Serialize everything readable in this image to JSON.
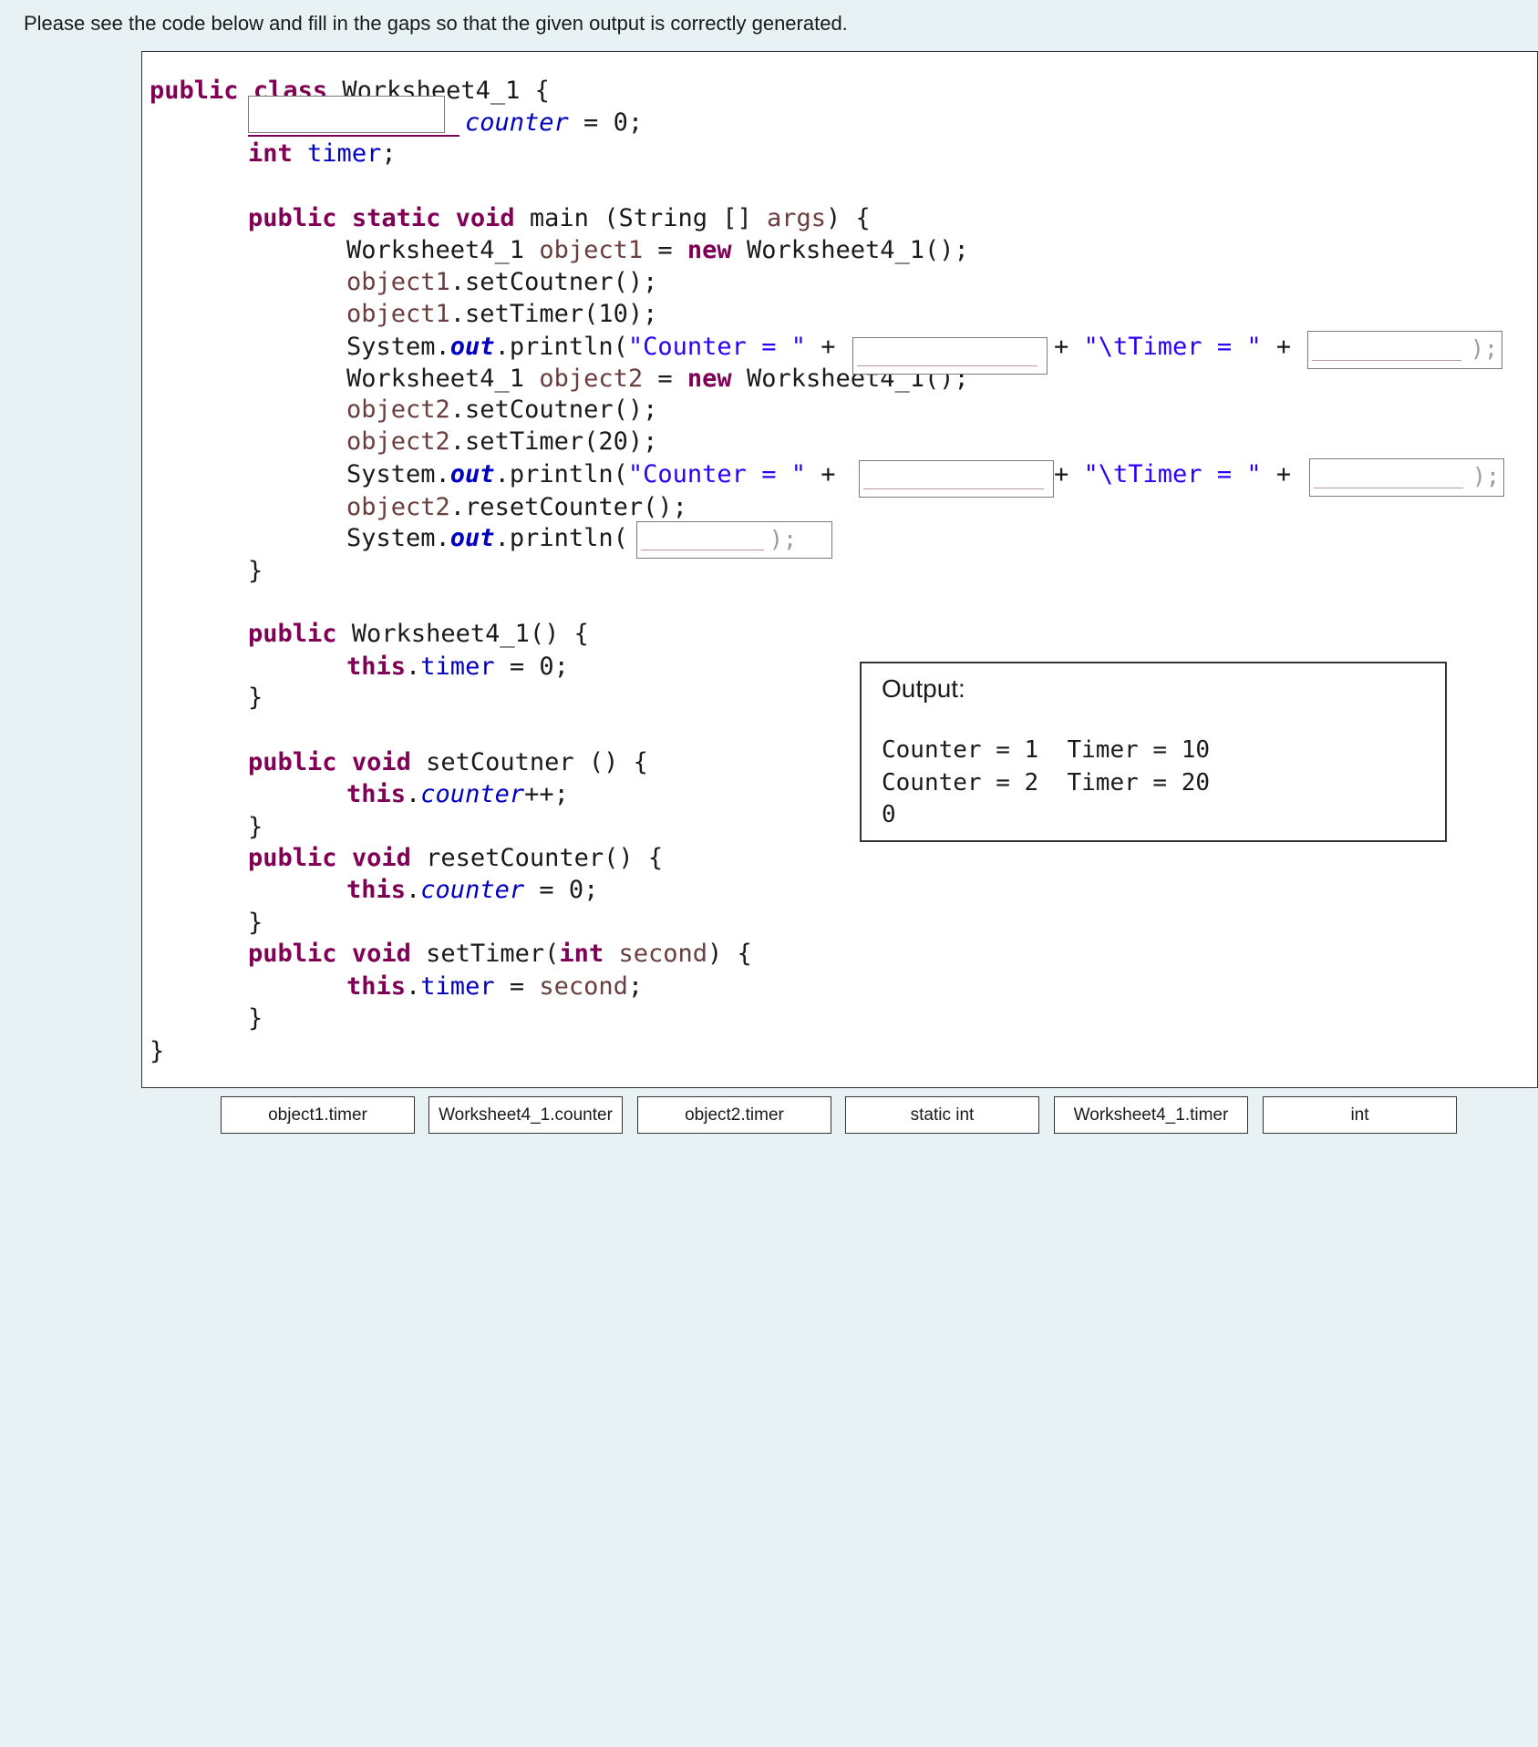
{
  "prompt": "Please see the code below and fill in the gaps so that the given output is correctly generated.",
  "code": {
    "l1": {
      "kw1": "public",
      "kw2": "class",
      "name": "Worksheet4_1 {"
    },
    "l2": {
      "field": "counter",
      "rest": " = 0;"
    },
    "l3": {
      "kw": "int",
      "field": "timer",
      "rest": ";"
    },
    "l4": {
      "kw1": "public",
      "kw2": "static",
      "kw3": "void",
      "name": " main (String [] ",
      "arg": "args",
      "rest": ") {"
    },
    "l5": {
      "type": "Worksheet4_1 ",
      "var": "object1",
      "eq": " = ",
      "kw": "new",
      "rest": " Worksheet4_1();"
    },
    "l6": {
      "var": "object1",
      "rest": ".setCoutner();"
    },
    "l7": {
      "var": "object1",
      "rest": ".setTimer(10);"
    },
    "l8": {
      "pre": "System.",
      "out": "out",
      "mid": ".println(",
      "str": "\"Counter = \"",
      "plus": " +",
      "plus2": "+ ",
      "str2": "\"\\tTimer = \"",
      "plus3": " +",
      "end": ");"
    },
    "l9": {
      "type": "Worksheet4_1 ",
      "var": "object2",
      "eq": " = ",
      "kw": "new",
      "rest": " Worksheet4_1();"
    },
    "l10": {
      "var": "object2",
      "rest": ".setCoutner();"
    },
    "l11": {
      "var": "object2",
      "rest": ".setTimer(20);"
    },
    "l12": {
      "pre": "System.",
      "out": "out",
      "mid": ".println(",
      "str": "\"Counter = \"",
      "plus": " +",
      "plus2": "+ ",
      "str2": "\"\\tTimer = \"",
      "plus3": " +",
      "end": ");"
    },
    "l13": {
      "var": "object2",
      "rest": ".resetCounter();"
    },
    "l14": {
      "pre": "System.",
      "out": "out",
      "mid": ".println(",
      "end": ");"
    },
    "l15": {
      "brace": "}"
    },
    "l16": {
      "kw": "public",
      "rest": " Worksheet4_1() {"
    },
    "l17": {
      "kw": "this",
      "dot": ".",
      "field": "timer",
      "rest": " = 0;"
    },
    "l18": {
      "brace": "}"
    },
    "l19": {
      "kw1": "public",
      "kw2": "void",
      "rest": " setCoutner () {"
    },
    "l20": {
      "kw": "this",
      "dot": ".",
      "field": "counter",
      "rest": "++;"
    },
    "l21": {
      "brace": "}"
    },
    "l22": {
      "kw1": "public",
      "kw2": "void",
      "rest": " resetCounter() {"
    },
    "l23": {
      "kw": "this",
      "dot": ".",
      "field": "counter",
      "rest": " = 0;"
    },
    "l24": {
      "brace": "}"
    },
    "l25": {
      "kw1": "public",
      "kw2": "void",
      "rest": " setTimer(",
      "kw3": "int",
      "arg": " second",
      "end": ") {"
    },
    "l26": {
      "kw": "this",
      "dot": ".",
      "field": "timer",
      "eq": " = ",
      "arg": "second",
      "rest": ";"
    },
    "l27": {
      "brace": "}"
    },
    "l28": {
      "brace": "}"
    }
  },
  "gaps": [
    {
      "id": "gap-counter-type",
      "value": ""
    },
    {
      "id": "gap-counter-1",
      "value": ""
    },
    {
      "id": "gap-timer-1",
      "value": ""
    },
    {
      "id": "gap-counter-2",
      "value": ""
    },
    {
      "id": "gap-timer-2",
      "value": ""
    },
    {
      "id": "gap-final-print",
      "value": ""
    }
  ],
  "gap_tail": ");",
  "output": {
    "title": "Output:",
    "lines": [
      "Counter = 1  Timer = 10",
      "Counter = 2  Timer = 20",
      "0"
    ]
  },
  "choices": [
    "object1.timer",
    "Worksheet4_1.counter",
    "object2.timer",
    "static int",
    "Worksheet4_1.timer",
    "int"
  ]
}
